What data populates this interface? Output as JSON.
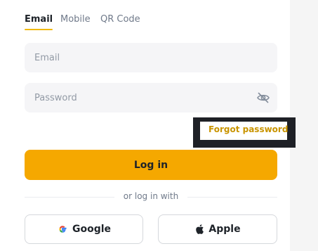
{
  "tabs": [
    {
      "label": "Email",
      "active": true
    },
    {
      "label": "Mobile",
      "active": false
    },
    {
      "label": "QR Code",
      "active": false
    }
  ],
  "email_field": {
    "placeholder": "Email",
    "value": ""
  },
  "password_field": {
    "placeholder": "Password",
    "value": "",
    "toggle_icon": "eye-off-icon"
  },
  "forgot_password": "Forgot password",
  "login_button": "Log in",
  "divider_text": "or log in with",
  "social": {
    "google": {
      "label": "Google",
      "icon": "google-icon"
    },
    "apple": {
      "label": "Apple",
      "icon": "apple-icon"
    }
  },
  "colors": {
    "accent": "#f0b90b",
    "login_button": "#f5a800",
    "link": "#c99400",
    "field_bg": "#f5f5f7"
  }
}
